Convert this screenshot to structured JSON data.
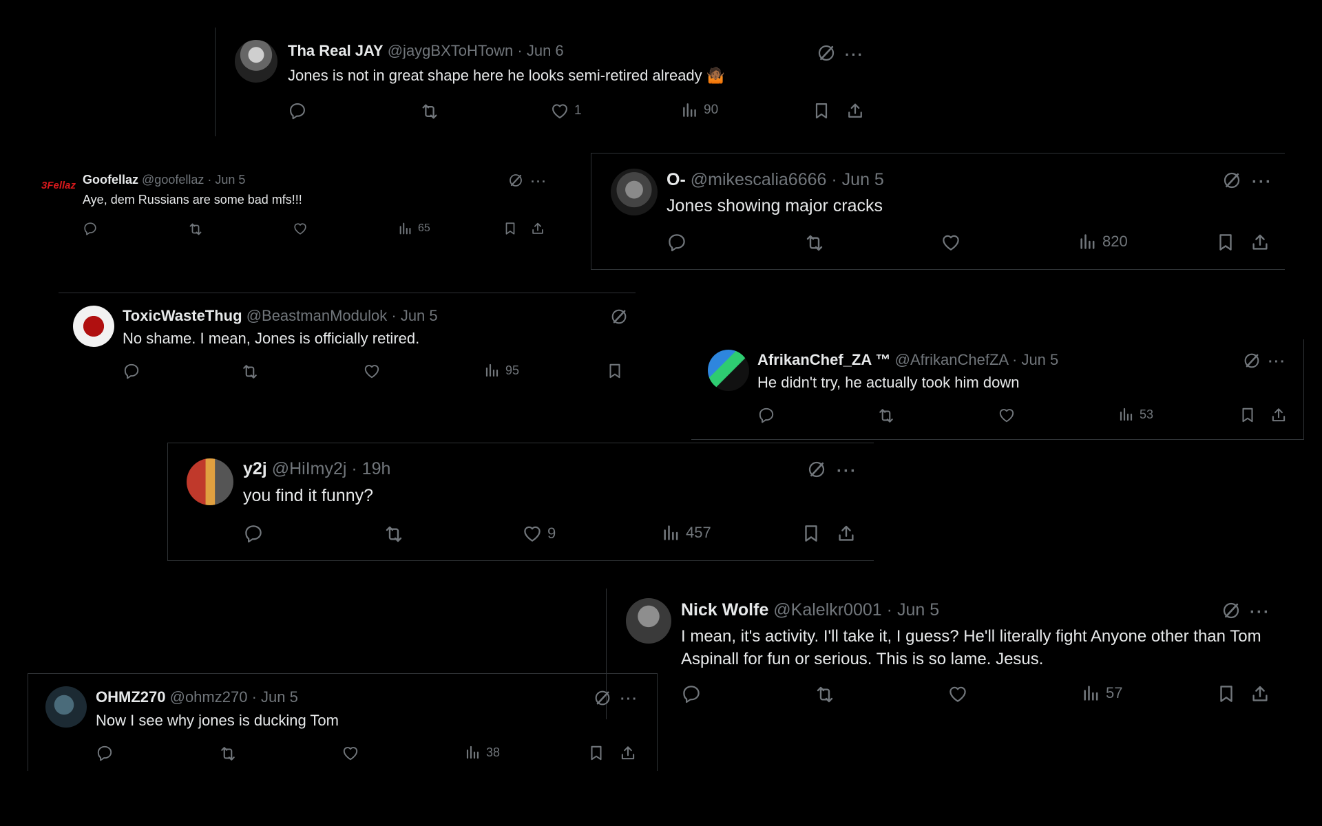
{
  "colors": {
    "background": "#000000",
    "text": "#e7e9ea",
    "muted": "#71767b",
    "border": "#2f3336"
  },
  "tweets": [
    {
      "name": "Tha Real JAY",
      "handle": "@jaygBXToHTown",
      "time": "Jun 6",
      "text": "Jones is not in great shape here he looks semi-retired already 🤷🏾",
      "likes": "1",
      "views": "90"
    },
    {
      "name": "Goofellaz",
      "handle": "@goofellaz",
      "time": "Jun 5",
      "text": "Aye, dem Russians are some bad mfs!!!",
      "views": "65",
      "avatar_text": "3Fellaz"
    },
    {
      "name": "O-",
      "handle": "@mikescalia6666",
      "time": "Jun 5",
      "text": "Jones showing major cracks",
      "views": "820"
    },
    {
      "name": "ToxicWasteThug",
      "handle": "@BeastmanModulok",
      "time": "Jun 5",
      "text": "No shame. I mean, Jones is officially retired.",
      "views": "95"
    },
    {
      "name": "AfrikanChef_ZA ™",
      "handle": "@AfrikanChefZA",
      "time": "Jun 5",
      "text": "He didn't try, he actually took him down",
      "views": "53"
    },
    {
      "name": "y2j",
      "handle": "@HiImy2j",
      "time": "19h",
      "text": "you find it funny?",
      "likes": "9",
      "views": "457"
    },
    {
      "name": "Nick Wolfe",
      "handle": "@Kalelkr0001",
      "time": "Jun 5",
      "text": "I mean, it's activity. I'll take it, I guess? He'll literally fight Anyone other than Tom Aspinall for fun or serious. This is so lame. Jesus.",
      "views": "57"
    },
    {
      "name": "OHMZ270",
      "handle": "@ohmz270",
      "time": "Jun 5",
      "text": "Now I see why jones is ducking Tom",
      "views": "38"
    }
  ],
  "separator": "·"
}
